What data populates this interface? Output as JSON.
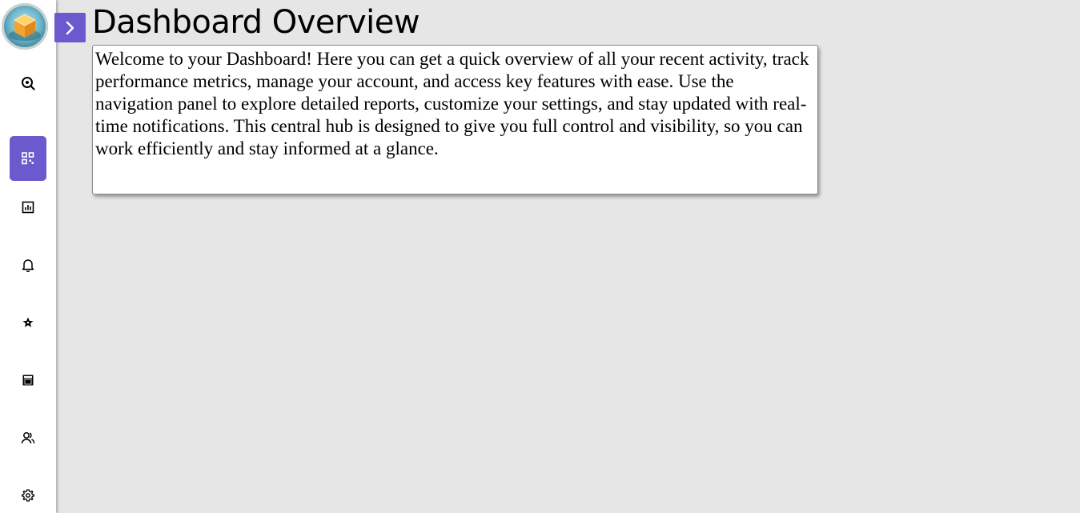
{
  "sidebar": {
    "items": [
      {
        "name": "search",
        "icon": "zoom-search-icon",
        "active": false
      },
      {
        "name": "dashboard",
        "icon": "dashboard-grid-icon",
        "active": true
      },
      {
        "name": "analytics",
        "icon": "bar-chart-icon",
        "active": false
      },
      {
        "name": "notifications",
        "icon": "bell-icon",
        "active": false
      },
      {
        "name": "favorites",
        "icon": "star-icon",
        "active": false
      },
      {
        "name": "store",
        "icon": "store-icon",
        "active": false
      },
      {
        "name": "users",
        "icon": "users-icon",
        "active": false
      },
      {
        "name": "settings",
        "icon": "gear-icon",
        "active": false
      }
    ]
  },
  "header": {
    "title": "Dashboard Overview"
  },
  "main": {
    "welcome_text": "Welcome to your Dashboard! Here you can get a quick overview of all your recent activity, track performance metrics, manage your account, and access key features with ease. Use the navigation panel to explore detailed reports, customize your settings, and stay updated with real-time notifications. This central hub is designed to give you full control and visibility, so you can work efficiently and stay informed at a glance."
  },
  "colors": {
    "accent": "#6a5acd",
    "background": "#e6e6e6",
    "sidebar": "#ffffff"
  }
}
